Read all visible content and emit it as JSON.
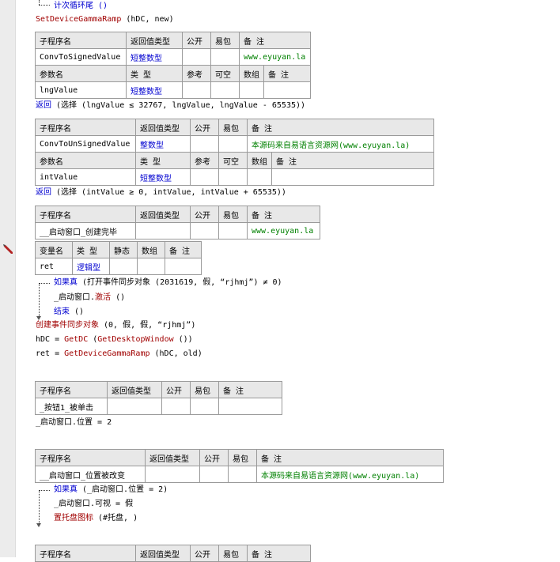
{
  "lines": {
    "loop_end": "计次循环尾 ()",
    "set_ramp_fn": "SetDeviceGammaRamp",
    "set_ramp_args": " (hDC, new)",
    "return1_kw": "返回",
    "return1_body": " (选择 (lngValue ≤ 32767, lngValue, lngValue - 65535))",
    "return2_kw": "返回",
    "return2_body": " (选择 (intValue ≥ 0, intValue, intValue + 65535))",
    "if1_kw": "如果真",
    "if1_body": " (打开事件同步对象 (2031619, 假, “rjhmj”) ≠ 0)",
    "activate_obj": "_启动窗口.",
    "activate_fn": "激活",
    "activate_args": " ()",
    "end_fn": "结束",
    "end_args": " ()",
    "create_evt_fn": "创建事件同步对象",
    "create_evt_args": " (0, 假, 假, “rjhmj”)",
    "hdc_lhs": "hDC = ",
    "hdc_fn": "GetDC",
    "hdc_mid": " (",
    "hdc_fn2": "GetDesktopWindow",
    "hdc_end": " ())",
    "ret_lhs": "ret = ",
    "ret_fn": "GetDeviceGammaRamp",
    "ret_args": " (hDC, old)",
    "pos_assign": "_启动窗口.位置 = 2",
    "if2_kw": "如果真",
    "if2_body": " (_启动窗口.位置 = 2)",
    "visible_assign": "_启动窗口.可视 = 假",
    "tray_fn": "置托盘图标",
    "tray_args": " (#托盘, )"
  },
  "sub_header": {
    "name": "子程序名",
    "ret_type": "返回值类型",
    "public": "公开",
    "easy_pkg": "易包",
    "note": "备 注"
  },
  "param_header": {
    "name": "参数名",
    "type": "类 型",
    "ref": "参考",
    "nullable": "可空",
    "array": "数组",
    "note": "备 注"
  },
  "var_header": {
    "name": "变量名",
    "type": "类 型",
    "static": "静态",
    "array": "数组",
    "note": "备 注"
  },
  "sub1": {
    "name": "ConvToSignedValue",
    "ret_type": "短整数型",
    "note": "www.eyuyan.la",
    "param_name": "lngValue",
    "param_type": "短整数型"
  },
  "sub2": {
    "name": "ConvToUnSignedValue",
    "ret_type": "整数型",
    "note": "本源码来自易语言资源网(www.eyuyan.la)",
    "param_name": "intValue",
    "param_type": "短整数型"
  },
  "sub3": {
    "name": "__启动窗口_创建完毕",
    "note": "www.eyuyan.la",
    "var_name": "ret",
    "var_type": "逻辑型"
  },
  "sub4": {
    "name": "_按钮1_被单击"
  },
  "sub5": {
    "name": "__启动窗口_位置被改变",
    "note": "本源码来自易语言资源网(www.eyuyan.la)"
  },
  "colors": {
    "keyword": "#0000d0",
    "function": "#a00000",
    "comment": "#008000",
    "header_bg": "#e8e8e8"
  },
  "icons": [
    "breakpoint-pencil-icon",
    "flow-arrow-icon"
  ]
}
